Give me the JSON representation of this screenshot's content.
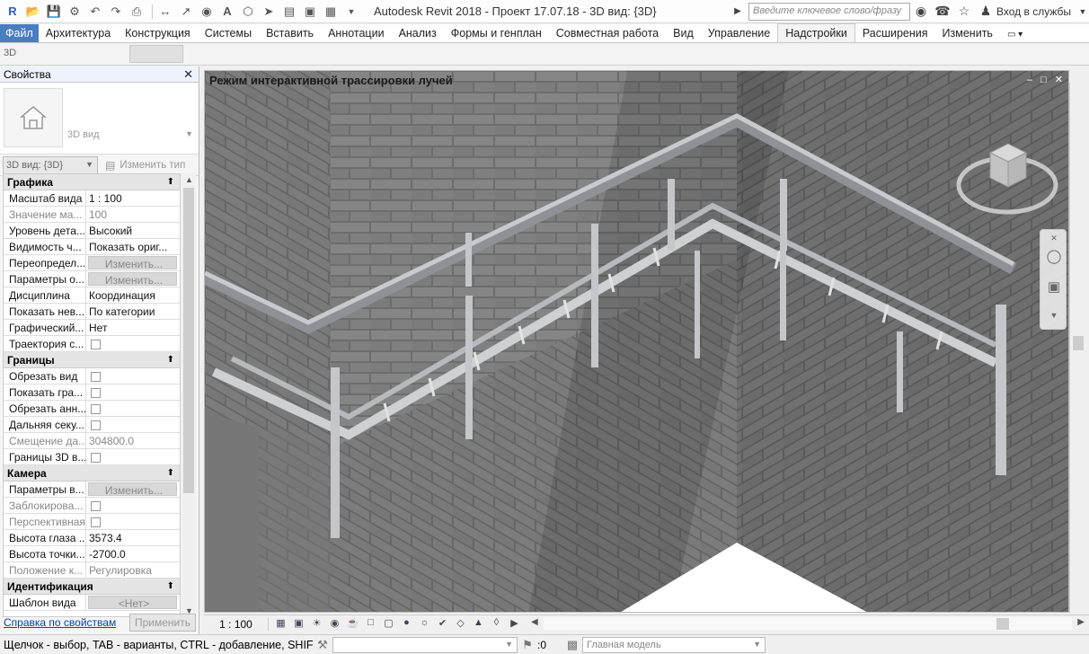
{
  "app": {
    "title": "Autodesk Revit 2018 -    Проект 17.07.18 - 3D вид: {3D}",
    "search_placeholder": "Введите ключевое слово/фразу",
    "login": "Вход в службы"
  },
  "ribbon": {
    "tabs": [
      {
        "label": "Файл"
      },
      {
        "label": "Архитектура"
      },
      {
        "label": "Конструкция"
      },
      {
        "label": "Системы"
      },
      {
        "label": "Вставить"
      },
      {
        "label": "Аннотации"
      },
      {
        "label": "Анализ"
      },
      {
        "label": "Формы и генплан"
      },
      {
        "label": "Совместная работа"
      },
      {
        "label": "Вид"
      },
      {
        "label": "Управление"
      },
      {
        "label": "Надстройки"
      },
      {
        "label": "Расширения"
      },
      {
        "label": "Изменить"
      }
    ],
    "active_tab": "Надстройки"
  },
  "options_bar": {
    "label": "3D"
  },
  "properties": {
    "title": "Свойства",
    "type_name": "3D вид",
    "instance_filter": "3D вид: {3D}",
    "edit_type": "Изменить тип",
    "sections": [
      {
        "name": "Графика",
        "rows": [
          {
            "key": "Масштаб вида",
            "value": "1 : 100",
            "kind": "text"
          },
          {
            "key": "Значение ма...",
            "value": "100",
            "kind": "text",
            "dim": true
          },
          {
            "key": "Уровень дета...",
            "value": "Высокий",
            "kind": "text"
          },
          {
            "key": "Видимость ч...",
            "value": "Показать ориг...",
            "kind": "text"
          },
          {
            "key": "Переопредел...",
            "value": "Изменить...",
            "kind": "button"
          },
          {
            "key": "Параметры о...",
            "value": "Изменить...",
            "kind": "button"
          },
          {
            "key": "Дисциплина",
            "value": "Координация",
            "kind": "text"
          },
          {
            "key": "Показать нев...",
            "value": "По категории",
            "kind": "text"
          },
          {
            "key": "Графический...",
            "value": "Нет",
            "kind": "text"
          },
          {
            "key": "Траектория с...",
            "value": "",
            "kind": "checkbox"
          }
        ]
      },
      {
        "name": "Границы",
        "rows": [
          {
            "key": "Обрезать вид",
            "value": "",
            "kind": "checkbox"
          },
          {
            "key": "Показать гра...",
            "value": "",
            "kind": "checkbox"
          },
          {
            "key": "Обрезать анн...",
            "value": "",
            "kind": "checkbox"
          },
          {
            "key": "Дальняя секу...",
            "value": "",
            "kind": "checkbox"
          },
          {
            "key": "Смещение да...",
            "value": "304800.0",
            "kind": "text",
            "dim": true
          },
          {
            "key": "Границы 3D в...",
            "value": "",
            "kind": "checkbox"
          }
        ]
      },
      {
        "name": "Камера",
        "rows": [
          {
            "key": "Параметры в...",
            "value": "Изменить...",
            "kind": "button"
          },
          {
            "key": "Заблокирова...",
            "value": "",
            "kind": "checkbox",
            "dim": true
          },
          {
            "key": "Перспективная",
            "value": "",
            "kind": "checkbox",
            "dim": true
          },
          {
            "key": "Высота глаза ...",
            "value": "3573.4",
            "kind": "text"
          },
          {
            "key": "Высота точки...",
            "value": "-2700.0",
            "kind": "text"
          },
          {
            "key": "Положение к...",
            "value": "Регулировка",
            "kind": "text",
            "dim": true
          }
        ]
      },
      {
        "name": "Идентификация",
        "rows": [
          {
            "key": "Шаблон вида",
            "value": "<Нет>",
            "kind": "button"
          }
        ]
      }
    ],
    "help_link": "Справка по свойствам",
    "apply": "Применить"
  },
  "viewport": {
    "title": "Режим интерактивной трассировки лучей",
    "scale": "1 : 100"
  },
  "status": {
    "text": "Щелчок - выбор, TAB - варианты, CTRL - добавление, SHIFT - ",
    "count": ":0",
    "model": "Главная модель"
  }
}
